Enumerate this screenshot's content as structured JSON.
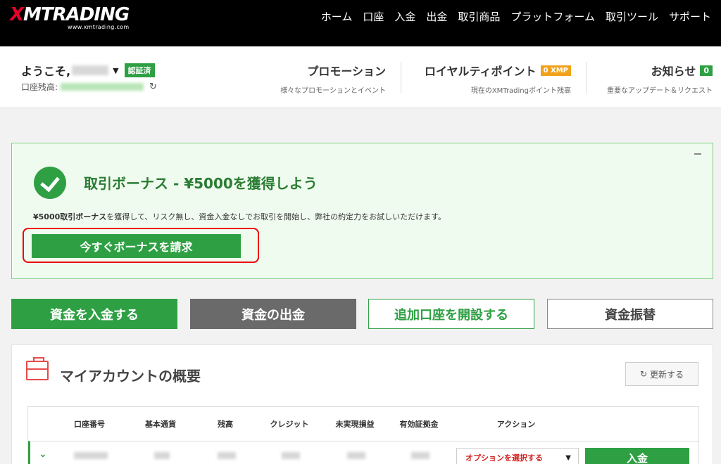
{
  "brand": {
    "logo": "XMTRADING",
    "logo_x": "X",
    "logo_rest": "MTRADING",
    "url": "www.xmtrading.com"
  },
  "nav": [
    "ホーム",
    "口座",
    "入金",
    "出金",
    "取引商品",
    "プラットフォーム",
    "取引ツール",
    "サポート"
  ],
  "account": {
    "welcome": "ようこそ,",
    "verified": "認証済",
    "balance_label": "口座残高:"
  },
  "header_items": {
    "promotion": {
      "title": "プロモーション",
      "sub": "様々なプロモーションとイベント"
    },
    "loyalty": {
      "title": "ロイヤルティポイント",
      "badge": "0 XMP",
      "sub": "現在のXMTradingポイント残高"
    },
    "news": {
      "title": "お知らせ",
      "badge": "0",
      "sub": "重要なアップデート＆リクエスト"
    }
  },
  "bonus": {
    "title": "取引ボーナス - ¥5000を獲得しよう",
    "desc_bold": "¥5000取引ボーナス",
    "desc_rest": "を獲得して、リスク無し、資金入金なしでお取引を開始し、弊社の約定力をお試しいただけます。",
    "claim_button": "今すぐボーナスを請求"
  },
  "actions": {
    "deposit": "資金を入金する",
    "withdraw": "資金の出金",
    "open_account": "追加口座を開設する",
    "transfer": "資金振替"
  },
  "overview": {
    "title": "マイアカウントの概要",
    "refresh": "更新する",
    "columns": [
      "口座番号",
      "基本通貨",
      "残高",
      "クレジット",
      "未実現損益",
      "有効証拠金",
      "アクション"
    ],
    "row": {
      "option_select": "オプションを選択する",
      "deposit_button": "入金"
    }
  },
  "colors": {
    "green": "#2ea043",
    "header_bg": "#000000",
    "panel_bg": "#f0fbef",
    "highlight": "#e00000"
  }
}
